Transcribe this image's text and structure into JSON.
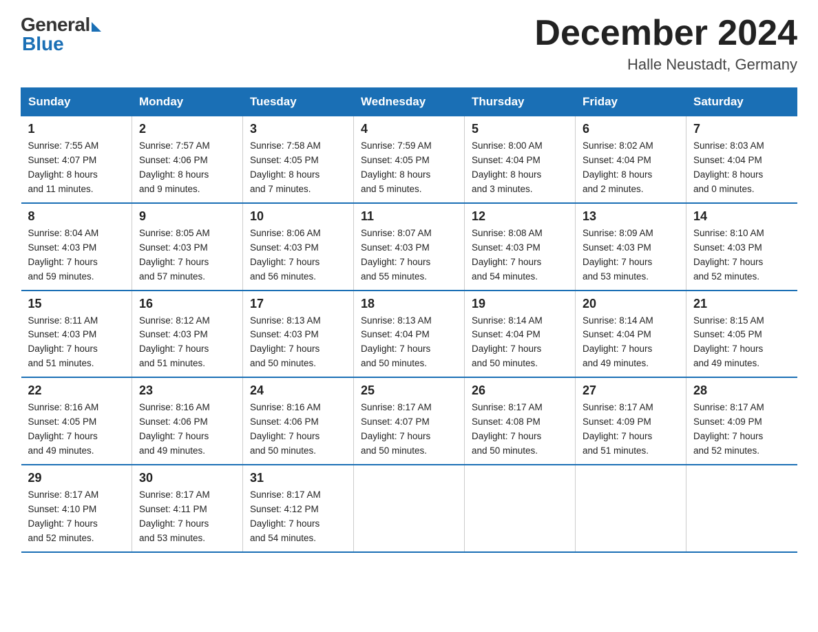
{
  "logo": {
    "general": "General",
    "blue": "Blue"
  },
  "title": {
    "month": "December 2024",
    "location": "Halle Neustadt, Germany"
  },
  "headers": [
    "Sunday",
    "Monday",
    "Tuesday",
    "Wednesday",
    "Thursday",
    "Friday",
    "Saturday"
  ],
  "weeks": [
    [
      {
        "day": "1",
        "info": "Sunrise: 7:55 AM\nSunset: 4:07 PM\nDaylight: 8 hours\nand 11 minutes."
      },
      {
        "day": "2",
        "info": "Sunrise: 7:57 AM\nSunset: 4:06 PM\nDaylight: 8 hours\nand 9 minutes."
      },
      {
        "day": "3",
        "info": "Sunrise: 7:58 AM\nSunset: 4:05 PM\nDaylight: 8 hours\nand 7 minutes."
      },
      {
        "day": "4",
        "info": "Sunrise: 7:59 AM\nSunset: 4:05 PM\nDaylight: 8 hours\nand 5 minutes."
      },
      {
        "day": "5",
        "info": "Sunrise: 8:00 AM\nSunset: 4:04 PM\nDaylight: 8 hours\nand 3 minutes."
      },
      {
        "day": "6",
        "info": "Sunrise: 8:02 AM\nSunset: 4:04 PM\nDaylight: 8 hours\nand 2 minutes."
      },
      {
        "day": "7",
        "info": "Sunrise: 8:03 AM\nSunset: 4:04 PM\nDaylight: 8 hours\nand 0 minutes."
      }
    ],
    [
      {
        "day": "8",
        "info": "Sunrise: 8:04 AM\nSunset: 4:03 PM\nDaylight: 7 hours\nand 59 minutes."
      },
      {
        "day": "9",
        "info": "Sunrise: 8:05 AM\nSunset: 4:03 PM\nDaylight: 7 hours\nand 57 minutes."
      },
      {
        "day": "10",
        "info": "Sunrise: 8:06 AM\nSunset: 4:03 PM\nDaylight: 7 hours\nand 56 minutes."
      },
      {
        "day": "11",
        "info": "Sunrise: 8:07 AM\nSunset: 4:03 PM\nDaylight: 7 hours\nand 55 minutes."
      },
      {
        "day": "12",
        "info": "Sunrise: 8:08 AM\nSunset: 4:03 PM\nDaylight: 7 hours\nand 54 minutes."
      },
      {
        "day": "13",
        "info": "Sunrise: 8:09 AM\nSunset: 4:03 PM\nDaylight: 7 hours\nand 53 minutes."
      },
      {
        "day": "14",
        "info": "Sunrise: 8:10 AM\nSunset: 4:03 PM\nDaylight: 7 hours\nand 52 minutes."
      }
    ],
    [
      {
        "day": "15",
        "info": "Sunrise: 8:11 AM\nSunset: 4:03 PM\nDaylight: 7 hours\nand 51 minutes."
      },
      {
        "day": "16",
        "info": "Sunrise: 8:12 AM\nSunset: 4:03 PM\nDaylight: 7 hours\nand 51 minutes."
      },
      {
        "day": "17",
        "info": "Sunrise: 8:13 AM\nSunset: 4:03 PM\nDaylight: 7 hours\nand 50 minutes."
      },
      {
        "day": "18",
        "info": "Sunrise: 8:13 AM\nSunset: 4:04 PM\nDaylight: 7 hours\nand 50 minutes."
      },
      {
        "day": "19",
        "info": "Sunrise: 8:14 AM\nSunset: 4:04 PM\nDaylight: 7 hours\nand 50 minutes."
      },
      {
        "day": "20",
        "info": "Sunrise: 8:14 AM\nSunset: 4:04 PM\nDaylight: 7 hours\nand 49 minutes."
      },
      {
        "day": "21",
        "info": "Sunrise: 8:15 AM\nSunset: 4:05 PM\nDaylight: 7 hours\nand 49 minutes."
      }
    ],
    [
      {
        "day": "22",
        "info": "Sunrise: 8:16 AM\nSunset: 4:05 PM\nDaylight: 7 hours\nand 49 minutes."
      },
      {
        "day": "23",
        "info": "Sunrise: 8:16 AM\nSunset: 4:06 PM\nDaylight: 7 hours\nand 49 minutes."
      },
      {
        "day": "24",
        "info": "Sunrise: 8:16 AM\nSunset: 4:06 PM\nDaylight: 7 hours\nand 50 minutes."
      },
      {
        "day": "25",
        "info": "Sunrise: 8:17 AM\nSunset: 4:07 PM\nDaylight: 7 hours\nand 50 minutes."
      },
      {
        "day": "26",
        "info": "Sunrise: 8:17 AM\nSunset: 4:08 PM\nDaylight: 7 hours\nand 50 minutes."
      },
      {
        "day": "27",
        "info": "Sunrise: 8:17 AM\nSunset: 4:09 PM\nDaylight: 7 hours\nand 51 minutes."
      },
      {
        "day": "28",
        "info": "Sunrise: 8:17 AM\nSunset: 4:09 PM\nDaylight: 7 hours\nand 52 minutes."
      }
    ],
    [
      {
        "day": "29",
        "info": "Sunrise: 8:17 AM\nSunset: 4:10 PM\nDaylight: 7 hours\nand 52 minutes."
      },
      {
        "day": "30",
        "info": "Sunrise: 8:17 AM\nSunset: 4:11 PM\nDaylight: 7 hours\nand 53 minutes."
      },
      {
        "day": "31",
        "info": "Sunrise: 8:17 AM\nSunset: 4:12 PM\nDaylight: 7 hours\nand 54 minutes."
      },
      {
        "day": "",
        "info": ""
      },
      {
        "day": "",
        "info": ""
      },
      {
        "day": "",
        "info": ""
      },
      {
        "day": "",
        "info": ""
      }
    ]
  ]
}
